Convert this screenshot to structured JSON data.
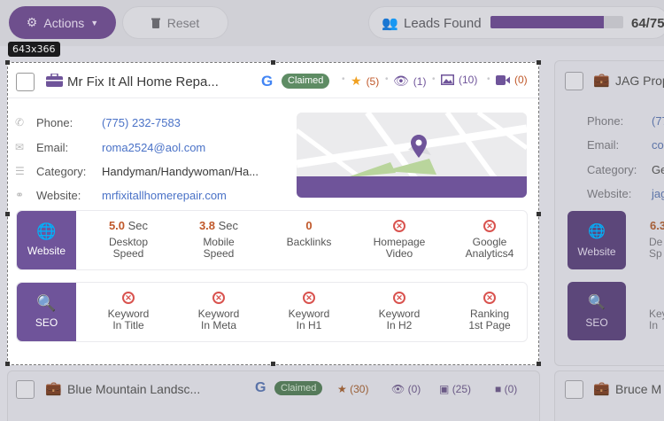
{
  "toolbar": {
    "actions_label": "Actions",
    "reset_label": "Reset",
    "leads_label": "Leads Found",
    "leads_count": "64/75",
    "leads_progress": 0.853
  },
  "capture": {
    "size_label": "643x366"
  },
  "card": {
    "name": "Mr Fix It All Home Repa...",
    "google_icon": "G",
    "claimed": "Claimed",
    "rating": "(5)",
    "views": "(1)",
    "photos": "(10)",
    "videos": "(0)",
    "phone_label": "Phone:",
    "phone": "(775) 232-7583",
    "email_label": "Email:",
    "email": "roma2524@aol.com",
    "category_label": "Category:",
    "category": "Handyman/Handywoman/Ha...",
    "website_label": "Website:",
    "website": "mrfixitallhomerepair.com",
    "website_panel": {
      "label": "Website",
      "desktop_value": "5.0",
      "desktop_unit": "Sec",
      "desktop_label": "Desktop\nSpeed",
      "mobile_value": "3.8",
      "mobile_unit": "Sec",
      "mobile_label": "Mobile\nSpeed",
      "backlinks_value": "0",
      "backlinks_label": "Backlinks",
      "video_label": "Homepage\nVideo",
      "analytics_label": "Google\nAnalytics4"
    },
    "seo_panel": {
      "label": "SEO",
      "kw_title": "Keyword\nIn Title",
      "kw_meta": "Keyword\nIn Meta",
      "kw_h1": "Keyword\nIn H1",
      "kw_h2": "Keyword\nIn H2",
      "ranking": "Ranking\n1st Page"
    }
  },
  "right_card": {
    "name": "JAG Prop",
    "phone_label": "Phone:",
    "phone": "(77",
    "email_label": "Email:",
    "email": "co",
    "category_label": "Category:",
    "category": "Ge",
    "website_label": "Website:",
    "website": "jag",
    "website_tile": "Website",
    "website_value": "6.3",
    "website_partial": "De\nSp",
    "seo_tile": "SEO",
    "seo_partial": "Key\nIn"
  },
  "bottom_card": {
    "name": "Blue Mountain Landsc...",
    "google_icon": "G",
    "claimed": "Claimed",
    "rating": "(30)",
    "views": "(0)",
    "photos": "(25)",
    "videos": "(0)"
  },
  "bottom_right_card": {
    "name": "Bruce M"
  },
  "colors": {
    "brand": "#6f549a",
    "claimed": "#5e8c64",
    "link": "#4a72c7",
    "accent": "#c0582a",
    "error": "#d9534f"
  }
}
